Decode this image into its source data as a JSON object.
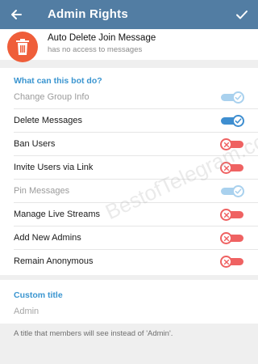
{
  "appbar": {
    "title": "Admin Rights",
    "back_icon": "arrow-left-icon",
    "confirm_icon": "check-icon"
  },
  "bot": {
    "name": "Auto Delete Join Message",
    "status": "has no access to messages",
    "icon": "trash-icon",
    "avatar_color": "#ef5e3a"
  },
  "permissions": {
    "header": "What can this bot do?",
    "items": [
      {
        "label": "Change Group Info",
        "state": "on",
        "enabled": false
      },
      {
        "label": "Delete Messages",
        "state": "on",
        "enabled": true
      },
      {
        "label": "Ban Users",
        "state": "off",
        "enabled": true
      },
      {
        "label": "Invite Users via Link",
        "state": "off",
        "enabled": true
      },
      {
        "label": "Pin Messages",
        "state": "on",
        "enabled": false
      },
      {
        "label": "Manage Live Streams",
        "state": "off",
        "enabled": true
      },
      {
        "label": "Add New Admins",
        "state": "off",
        "enabled": true
      },
      {
        "label": "Remain Anonymous",
        "state": "off",
        "enabled": true
      }
    ]
  },
  "custom_title": {
    "header": "Custom title",
    "placeholder": "Admin",
    "value": "",
    "hint": "A title that members will see instead of 'Admin'."
  },
  "watermark": "BestofTelegram.com",
  "colors": {
    "appbar": "#527da3",
    "accent": "#3a95d0",
    "toggle_on": "#3e8ed0",
    "toggle_on_disabled": "#a9d1ee",
    "toggle_off": "#ef6262"
  }
}
